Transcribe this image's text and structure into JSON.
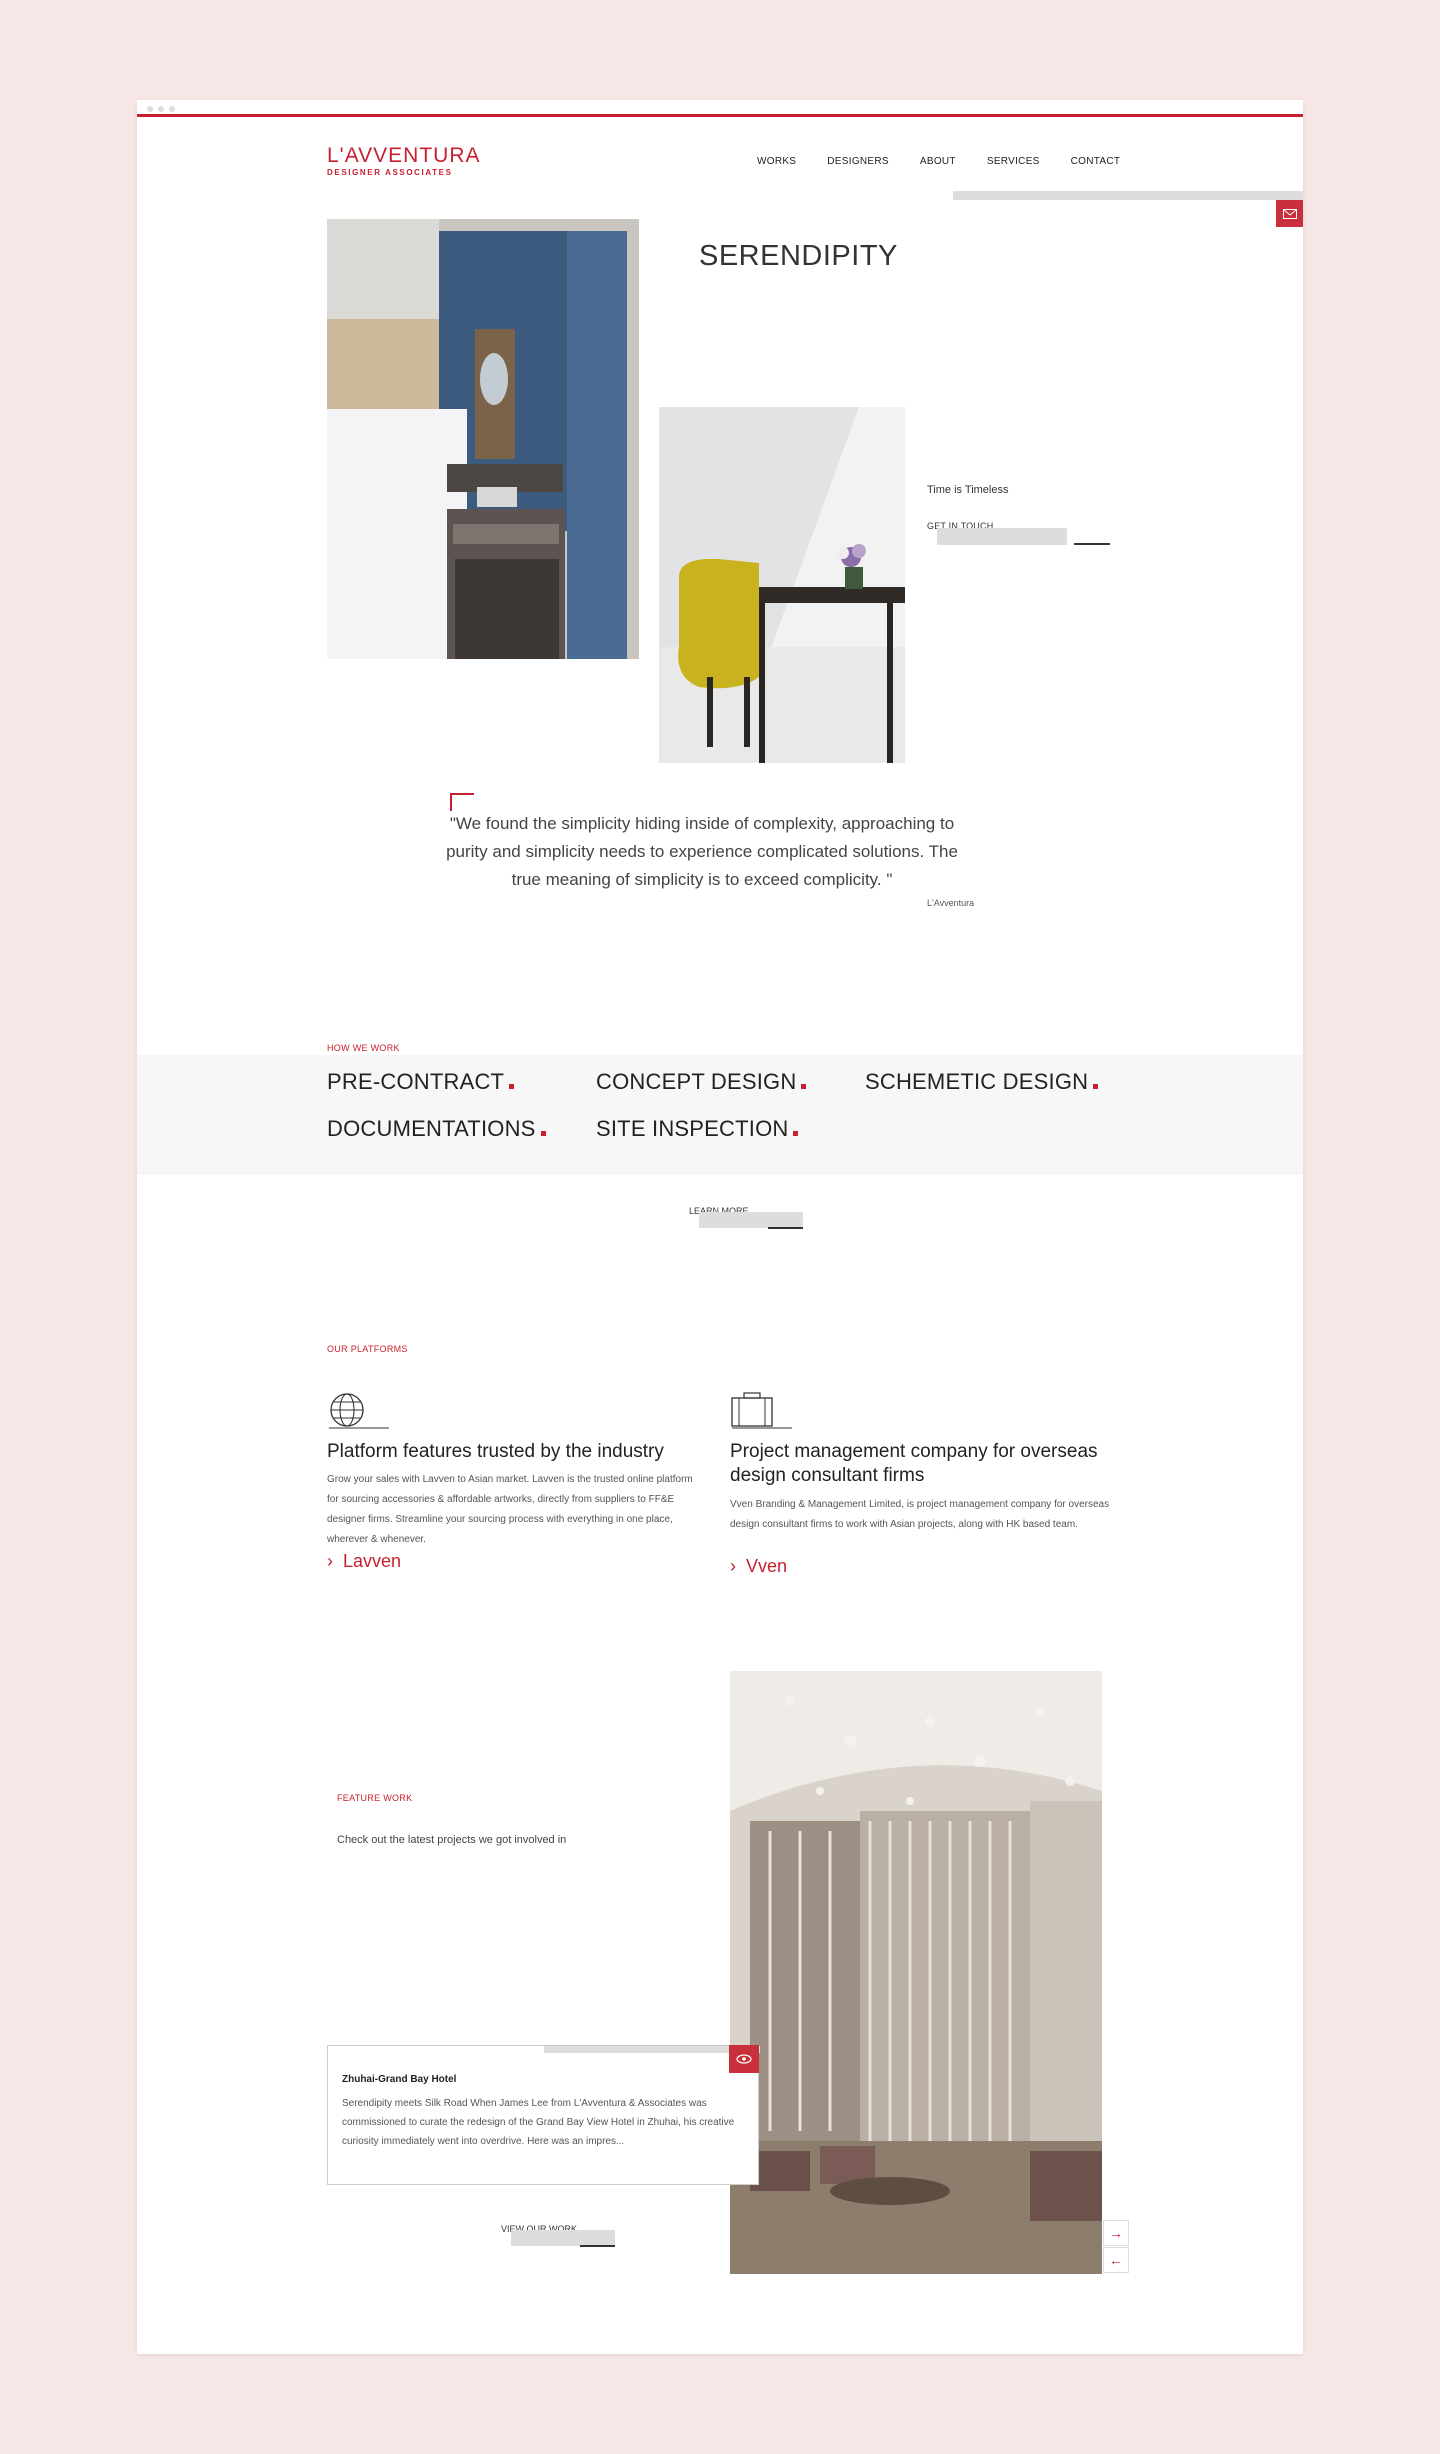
{
  "brand": {
    "name": "L'AVVENTURA",
    "subtitle": "DESIGNER ASSOCIATES",
    "accent_color": "#c8202f"
  },
  "nav": {
    "items": [
      "WORKS",
      "DESIGNERS",
      "ABOUT",
      "SERVICES",
      "CONTACT"
    ]
  },
  "hero": {
    "title": "SERENDIPITY",
    "tagline": "Time is Timeless",
    "cta": "GET IN TOUCH"
  },
  "quote": {
    "text": "\"We found the simplicity hiding inside of complexity, approaching to purity and simplicity needs to experience complicated solutions. The true meaning of simplicity is to exceed complicity. \"",
    "author": "L'Avventura"
  },
  "how_we_work": {
    "label": "HOW WE WORK",
    "items": [
      "PRE-CONTRACT",
      "CONCEPT DESIGN",
      "SCHEMETIC DESIGN",
      "DOCUMENTATIONS",
      "SITE INSPECTION"
    ],
    "cta": "LEARN MORE"
  },
  "platforms": {
    "label": "OUR PLATFORMS",
    "items": [
      {
        "icon": "globe-icon",
        "title": "Platform features trusted by the industry",
        "description": "Grow your sales with Lavven to Asian market. Lavven is the trusted online platform for sourcing accessories & affordable artworks, directly from suppliers to FF&E designer firms. Streamline your sourcing process with everything in one place, wherever & whenever.",
        "link": "Lavven"
      },
      {
        "icon": "briefcase-icon",
        "title": "Project management company for overseas design consultant firms",
        "description": "Vven Branding & Management Limited, is project management company for overseas design consultant firms to work with Asian projects, along with HK based team.",
        "link": "Vven"
      }
    ]
  },
  "feature_work": {
    "label": "FEATURE WORK",
    "description": "Check out the latest projects we got involved in",
    "card": {
      "title": "Zhuhai-Grand Bay Hotel",
      "body": "Serendipity meets Silk Road When James Lee from L'Avventura & Associates was commissioned to curate the redesign of the Grand Bay View Hotel in Zhuhai, his creative curiosity immediately went into overdrive. Here was an impres..."
    },
    "cta": "VIEW OUR WORK"
  }
}
